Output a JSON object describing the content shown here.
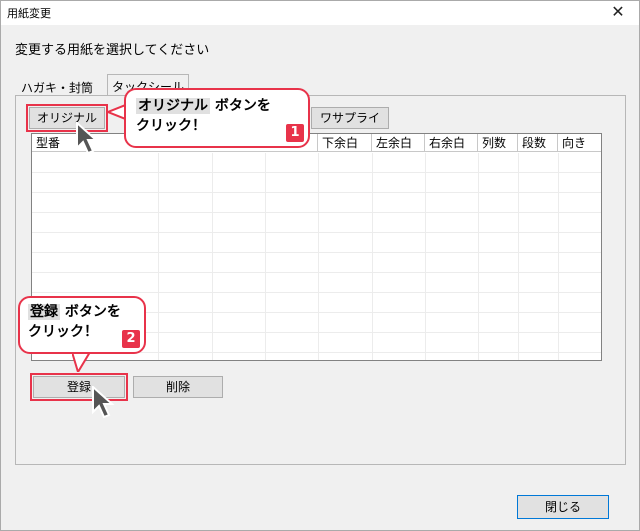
{
  "window": {
    "title": "用紙変更"
  },
  "instruction": "変更する用紙を選択してください",
  "tabs": [
    {
      "label": "ハガキ・封筒"
    },
    {
      "label": "タックシール"
    }
  ],
  "buttons": {
    "original": "オリジナル",
    "supply": "ワサプライ",
    "register": "登録",
    "delete": "削除",
    "close": "閉じる"
  },
  "grid": {
    "headers": [
      "型番",
      "下余白",
      "左余白",
      "右余白",
      "列数",
      "段数",
      "向き"
    ]
  },
  "callouts": {
    "c1": {
      "highlight": "オリジナル",
      "line1_rest": " ボタンを",
      "line2": "クリック！",
      "badge": "1"
    },
    "c2": {
      "highlight": "登録",
      "line1_rest": " ボタンを",
      "line2": "クリック！",
      "badge": "2"
    }
  },
  "colors": {
    "accent": "#e8334a"
  },
  "icons": {
    "close": "close-icon",
    "cursor": "mouse-pointer-icon"
  }
}
